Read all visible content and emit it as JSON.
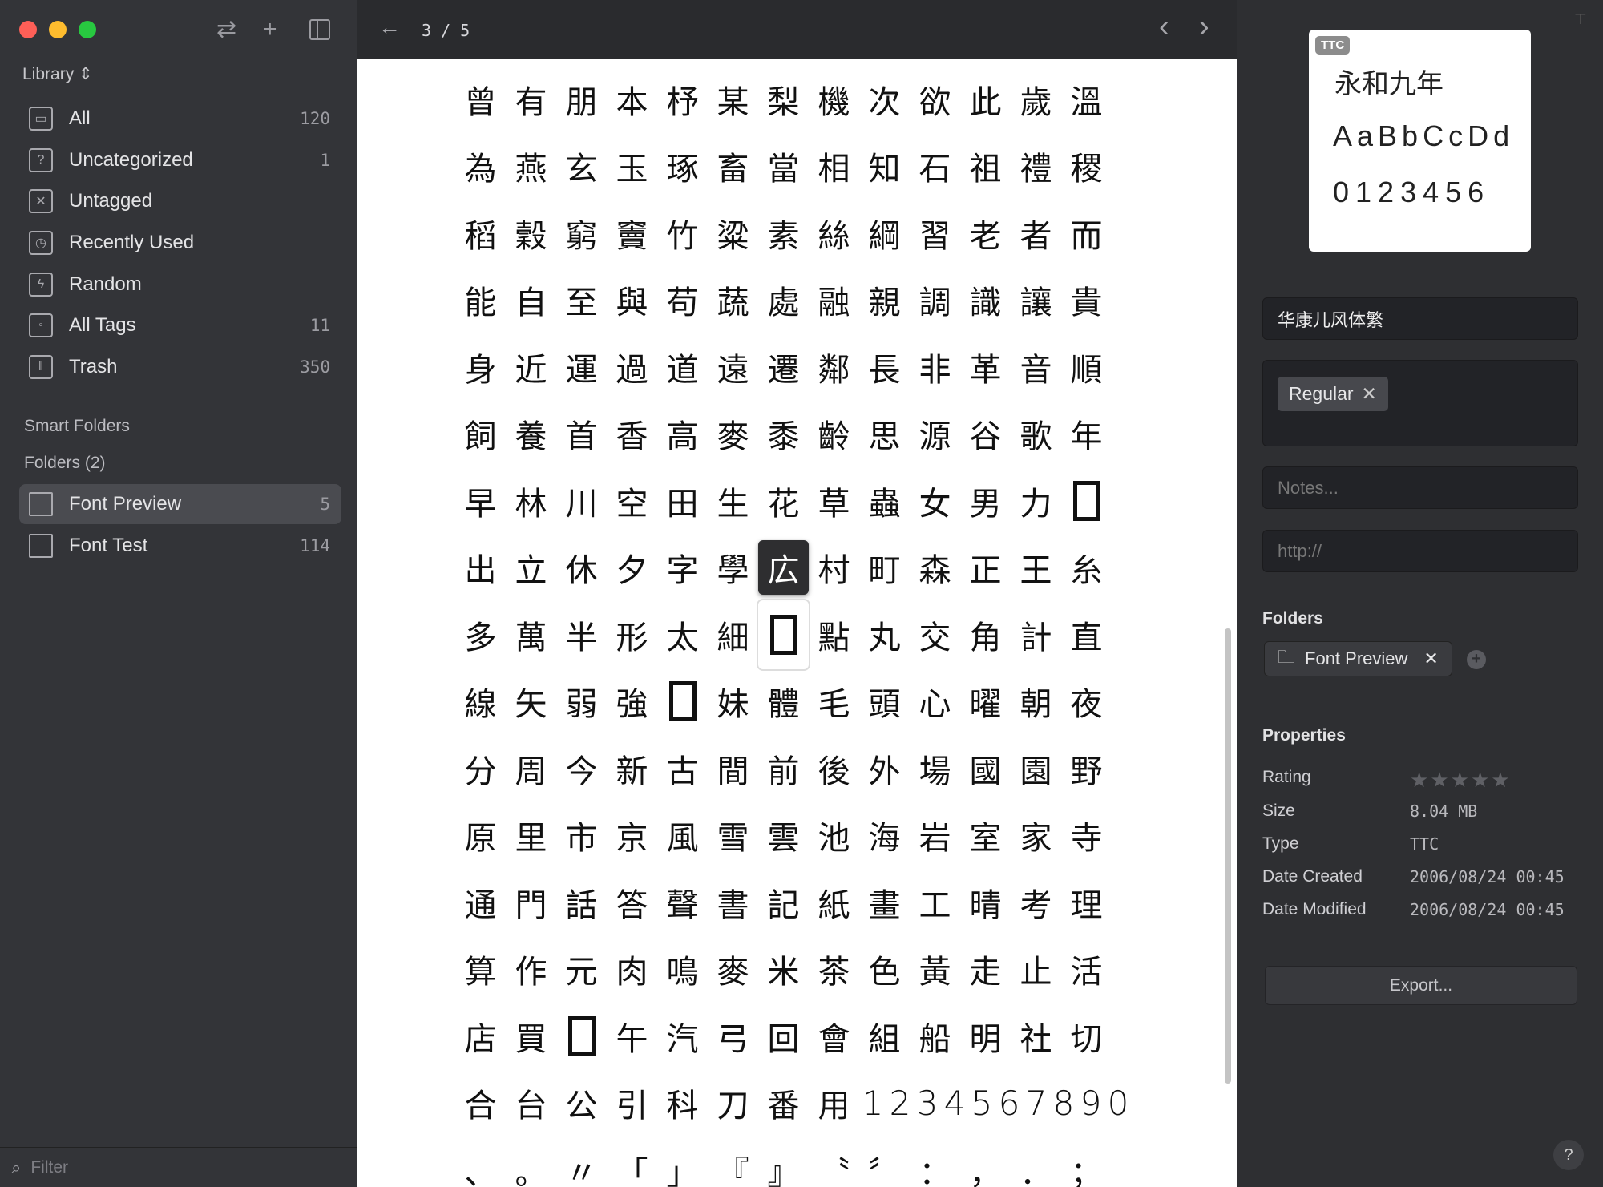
{
  "sidebar": {
    "library_label": "Library",
    "items": [
      {
        "label": "All",
        "count": "120",
        "icon": "archive-box-icon",
        "glyph": "▭"
      },
      {
        "label": "Uncategorized",
        "count": "1",
        "icon": "question-stack-icon",
        "glyph": "?"
      },
      {
        "label": "Untagged",
        "count": "",
        "icon": "untagged-bookmark-icon",
        "glyph": "✕"
      },
      {
        "label": "Recently Used",
        "count": "",
        "icon": "clock-icon",
        "glyph": "◷"
      },
      {
        "label": "Random",
        "count": "",
        "icon": "lightbulb-icon",
        "glyph": "ϟ"
      },
      {
        "label": "All Tags",
        "count": "11",
        "icon": "tags-icon",
        "glyph": "◦"
      },
      {
        "label": "Trash",
        "count": "350",
        "icon": "trash-icon",
        "glyph": "‖"
      }
    ],
    "smart_folders_label": "Smart Folders",
    "folders_label": "Folders (2)",
    "folders": [
      {
        "label": "Font Preview",
        "count": "5"
      },
      {
        "label": "Font Test",
        "count": "114"
      }
    ],
    "filter_placeholder": "Filter"
  },
  "toolbar": {
    "swap_glyph": "⇄",
    "add_glyph": "+",
    "page_indicator": "3 / 5",
    "back_glyph": "←",
    "prev_glyph": "‹",
    "next_glyph": "›"
  },
  "glyph_grid": [
    [
      "曾",
      "有",
      "朋",
      "本",
      "杼",
      "某",
      "梨",
      "機",
      "次",
      "欲",
      "此",
      "歲",
      "溫"
    ],
    [
      "為",
      "燕",
      "玄",
      "玉",
      "琢",
      "畜",
      "當",
      "相",
      "知",
      "石",
      "祖",
      "禮",
      "稷"
    ],
    [
      "稻",
      "穀",
      "窮",
      "竇",
      "竹",
      "粱",
      "素",
      "絲",
      "綱",
      "習",
      "老",
      "者",
      "而"
    ],
    [
      "能",
      "自",
      "至",
      "與",
      "苟",
      "蔬",
      "處",
      "融",
      "親",
      "調",
      "識",
      "讓",
      "貴"
    ],
    [
      "身",
      "近",
      "運",
      "過",
      "道",
      "遠",
      "遷",
      "鄰",
      "長",
      "非",
      "革",
      "音",
      "順"
    ],
    [
      "飼",
      "養",
      "首",
      "香",
      "高",
      "麥",
      "黍",
      "齡",
      "思",
      "源",
      "谷",
      "歌",
      "年"
    ],
    [
      "早",
      "林",
      "川",
      "空",
      "田",
      "生",
      "花",
      "草",
      "蟲",
      "女",
      "男",
      "力",
      "□"
    ],
    [
      "出",
      "立",
      "休",
      "夕",
      "字",
      "學",
      "広",
      "村",
      "町",
      "森",
      "正",
      "王",
      "糸"
    ],
    [
      "多",
      "萬",
      "半",
      "形",
      "太",
      "細",
      "□",
      "點",
      "丸",
      "交",
      "角",
      "計",
      "直"
    ],
    [
      "線",
      "矢",
      "弱",
      "強",
      "□",
      "妹",
      "體",
      "毛",
      "頭",
      "心",
      "曜",
      "朝",
      "夜"
    ],
    [
      "分",
      "周",
      "今",
      "新",
      "古",
      "間",
      "前",
      "後",
      "外",
      "場",
      "國",
      "園",
      "野"
    ],
    [
      "原",
      "里",
      "市",
      "京",
      "風",
      "雪",
      "雲",
      "池",
      "海",
      "岩",
      "室",
      "家",
      "寺"
    ],
    [
      "通",
      "門",
      "話",
      "答",
      "聲",
      "書",
      "記",
      "紙",
      "畫",
      "工",
      "晴",
      "考",
      "理"
    ],
    [
      "算",
      "作",
      "元",
      "肉",
      "鳴",
      "麥",
      "米",
      "茶",
      "色",
      "黃",
      "走",
      "止",
      "活"
    ],
    [
      "店",
      "買",
      "□",
      "午",
      "汽",
      "弓",
      "回",
      "會",
      "組",
      "船",
      "明",
      "社",
      "切"
    ],
    [
      "合",
      "台",
      "公",
      "引",
      "科",
      "刀",
      "番",
      "用",
      "1",
      "2",
      "3",
      "4",
      "5",
      "6",
      "7",
      "8",
      "9",
      "0"
    ],
    [
      "、",
      "。",
      "〃",
      "「",
      "」",
      "『",
      "』",
      "〝",
      "〞",
      "：",
      "，",
      "．",
      "；"
    ]
  ],
  "selected_glyph": {
    "row": 7,
    "col": 6
  },
  "hovered_glyph": {
    "row": 8,
    "col": 6
  },
  "inspector": {
    "badge": "TTC",
    "preview_lines": [
      "永和九年",
      "AaBbCcDd",
      "0123456"
    ],
    "font_name": "华康儿风体繁",
    "tags": [
      {
        "label": "Regular"
      }
    ],
    "notes_placeholder": "Notes...",
    "url_placeholder": "http://",
    "folders_label": "Folders",
    "folder_chip": "Font Preview",
    "properties_label": "Properties",
    "rating_label": "Rating",
    "rating_value": 0,
    "rating_max": 5,
    "size_label": "Size",
    "size_value": "8.04 MB",
    "type_label": "Type",
    "type_value": "TTC",
    "created_label": "Date Created",
    "created_value": "2006/08/24 00:45",
    "modified_label": "Date Modified",
    "modified_value": "2006/08/24 00:45",
    "export_label": "Export...",
    "help_label": "?"
  }
}
